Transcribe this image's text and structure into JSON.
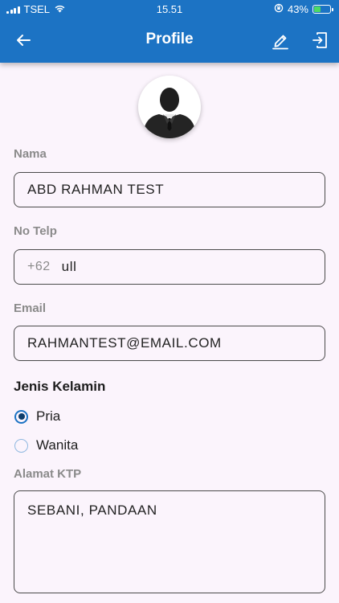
{
  "status_bar": {
    "carrier": "TSEL",
    "time": "15.51",
    "battery_percent": "43%",
    "battery_level": 0.43
  },
  "appbar": {
    "title": "Profile",
    "back_icon": "arrow-left-icon",
    "edit_icon": "pencil-icon",
    "logout_icon": "logout-icon"
  },
  "avatar": {
    "icon": "person-silhouette-icon"
  },
  "form": {
    "nama": {
      "label": "Nama",
      "value": "ABD RAHMAN TEST"
    },
    "telp": {
      "label": "No Telp",
      "prefix": "+62",
      "value": "ull"
    },
    "email": {
      "label": "Email",
      "value": "RAHMANTEST@EMAIL.COM"
    },
    "gender": {
      "title": "Jenis Kelamin",
      "options": [
        {
          "label": "Pria",
          "selected": true
        },
        {
          "label": "Wanita",
          "selected": false
        }
      ]
    },
    "alamat": {
      "label": "Alamat KTP",
      "value": "SEBANI, PANDAAN"
    }
  },
  "colors": {
    "primary": "#1c73c4",
    "background": "#fbf4fc",
    "radio_selected": "#0d3d6b"
  }
}
